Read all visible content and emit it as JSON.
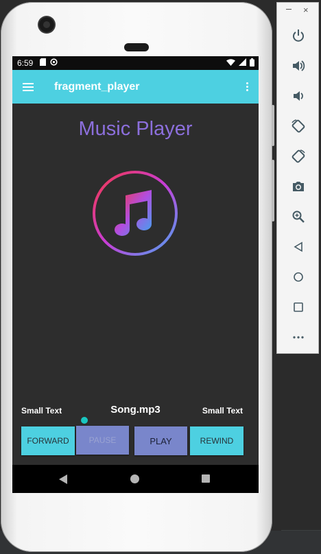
{
  "status_bar": {
    "time": "6:59"
  },
  "app_bar": {
    "title": "fragment_player"
  },
  "main": {
    "heading": "Music Player",
    "left_label": "Small Text",
    "song_name": "Song.mp3",
    "right_label": "Small Text",
    "seek_progress": 0.02
  },
  "controls": {
    "forward_label": "FORWARD",
    "pause_label": "PAUSE",
    "play_label": "PLAY",
    "rewind_label": "REWIND"
  },
  "icons": {
    "menu": "hamburger-menu-icon",
    "overflow": "more-vert-icon",
    "logo": "music-note-icon",
    "toolbar": [
      "power-icon",
      "volume-up-icon",
      "volume-down-icon",
      "rotate-left-icon",
      "rotate-right-icon",
      "camera-icon",
      "zoom-icon",
      "back-icon",
      "home-icon",
      "overview-icon",
      "more-icon"
    ]
  },
  "colors": {
    "app_bar": "#4dd0e1",
    "heading": "#8c6fdc",
    "accent_button": "#4dd0e1",
    "primary_button": "#7986cb",
    "seek_thumb": "#19c6c0"
  }
}
